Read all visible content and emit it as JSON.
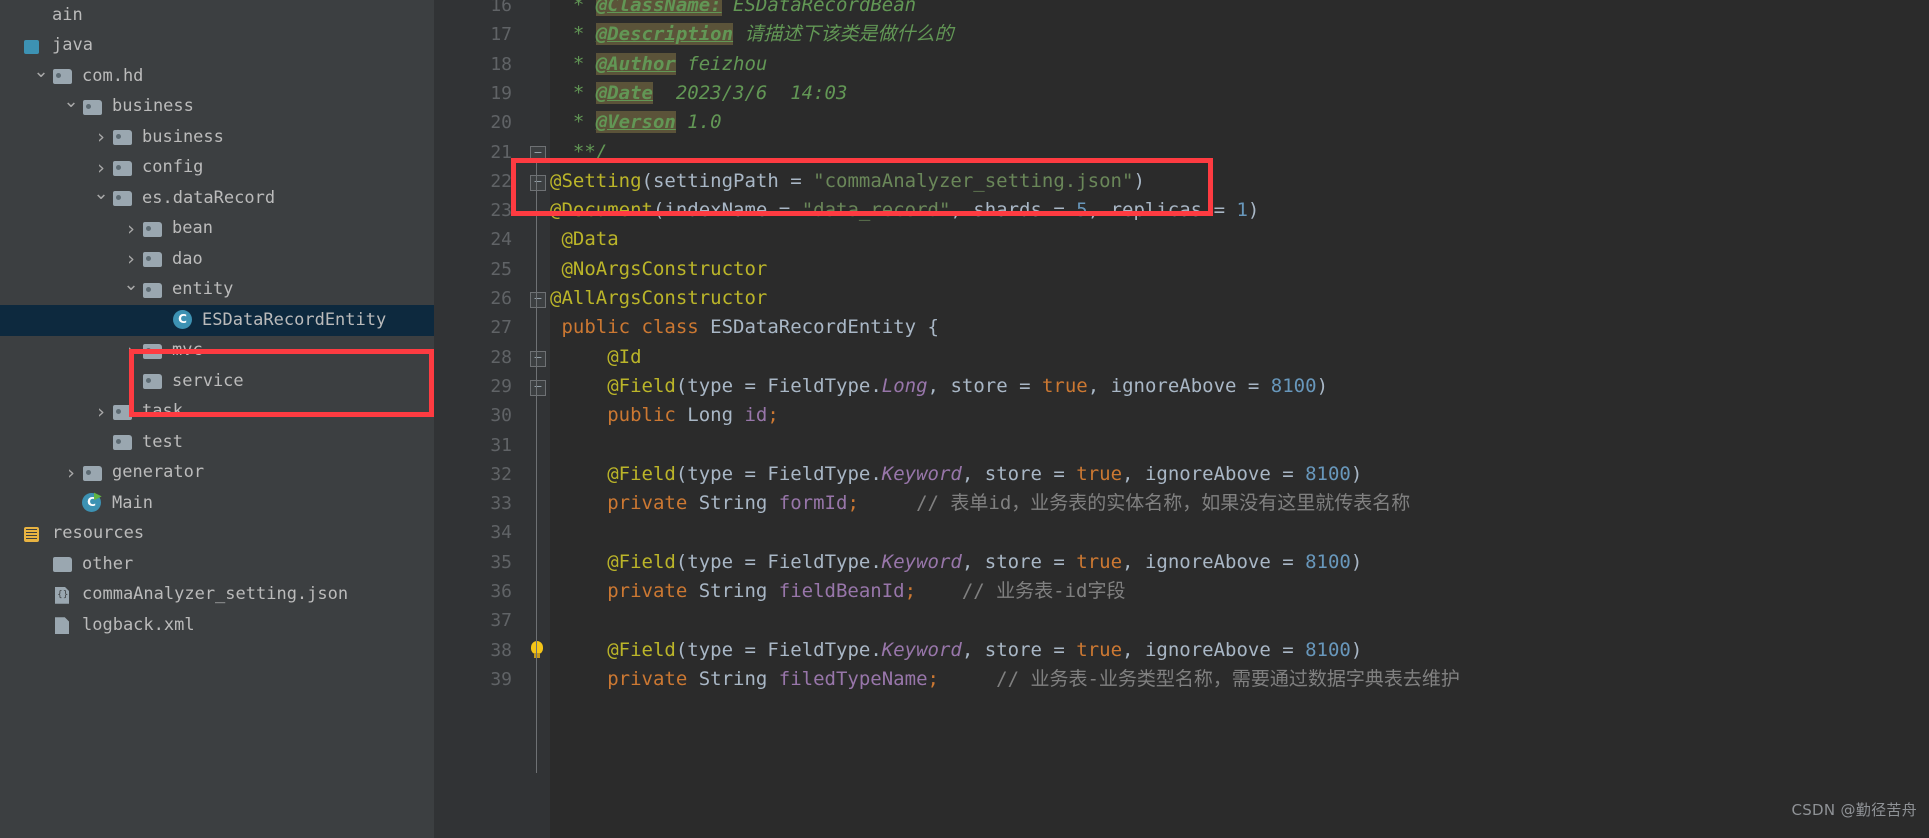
{
  "app": {
    "name": "IntelliJ IDEA Project View with Java Editor",
    "theme_accent": "#3d92b3",
    "annotation_color": "#fe3b41",
    "selection_color": "#0d293e"
  },
  "sidebar": {
    "items": [
      {
        "label": "ain",
        "indent": 0,
        "arrow": "none",
        "icon": "none",
        "selected": false
      },
      {
        "label": "java",
        "indent": 0,
        "arrow": "none",
        "icon": "source-root",
        "selected": false
      },
      {
        "label": "com.hd",
        "indent": 1,
        "arrow": "down",
        "icon": "folder",
        "selected": false
      },
      {
        "label": "business",
        "indent": 2,
        "arrow": "down",
        "icon": "folder",
        "selected": false
      },
      {
        "label": "business",
        "indent": 3,
        "arrow": "right",
        "icon": "folder",
        "selected": false
      },
      {
        "label": "config",
        "indent": 3,
        "arrow": "right",
        "icon": "folder",
        "selected": false
      },
      {
        "label": "es.dataRecord",
        "indent": 3,
        "arrow": "down",
        "icon": "folder",
        "selected": false
      },
      {
        "label": "bean",
        "indent": 4,
        "arrow": "right",
        "icon": "folder",
        "selected": false
      },
      {
        "label": "dao",
        "indent": 4,
        "arrow": "right",
        "icon": "folder",
        "selected": false
      },
      {
        "label": "entity",
        "indent": 4,
        "arrow": "down",
        "icon": "folder",
        "selected": false
      },
      {
        "label": "ESDataRecordEntity",
        "indent": 5,
        "arrow": "none",
        "icon": "class",
        "selected": true
      },
      {
        "label": "mvc",
        "indent": 4,
        "arrow": "right",
        "icon": "folder",
        "selected": false
      },
      {
        "label": "service",
        "indent": 4,
        "arrow": "right",
        "icon": "folder",
        "selected": false
      },
      {
        "label": "task",
        "indent": 3,
        "arrow": "right",
        "icon": "folder",
        "selected": false
      },
      {
        "label": "test",
        "indent": 3,
        "arrow": "none",
        "icon": "folder",
        "selected": false
      },
      {
        "label": "generator",
        "indent": 2,
        "arrow": "right",
        "icon": "folder",
        "selected": false
      },
      {
        "label": "Main",
        "indent": 2,
        "arrow": "none",
        "icon": "main-class",
        "selected": false
      },
      {
        "label": "resources",
        "indent": 0,
        "arrow": "none",
        "icon": "resource-root",
        "selected": false
      },
      {
        "label": "other",
        "indent": 1,
        "arrow": "none",
        "icon": "folder-plain",
        "selected": false
      },
      {
        "label": "commaAnalyzer_setting.json",
        "indent": 1,
        "arrow": "none",
        "icon": "json-file",
        "selected": false
      },
      {
        "label": "logback.xml",
        "indent": 1,
        "arrow": "none",
        "icon": "xml-file",
        "selected": false
      }
    ]
  },
  "editor": {
    "first_line_number": 16,
    "lines": [
      {
        "n": 16,
        "marker": "none",
        "tokens": [
          {
            "t": "  * ",
            "c": "jdoc"
          },
          {
            "t": "@ClassName:",
            "c": "jdoc-tag"
          },
          {
            "t": " ESDataRecordBean",
            "c": "jdoc"
          }
        ]
      },
      {
        "n": 17,
        "marker": "none",
        "tokens": [
          {
            "t": "  * ",
            "c": "jdoc"
          },
          {
            "t": "@Description",
            "c": "jdoc-tag"
          },
          {
            "t": " 请描述下该类是做什么的",
            "c": "jdoc"
          }
        ]
      },
      {
        "n": 18,
        "marker": "none",
        "tokens": [
          {
            "t": "  * ",
            "c": "jdoc"
          },
          {
            "t": "@Author",
            "c": "jdoc-tag"
          },
          {
            "t": " feizhou",
            "c": "jdoc"
          }
        ]
      },
      {
        "n": 19,
        "marker": "none",
        "tokens": [
          {
            "t": "  * ",
            "c": "jdoc"
          },
          {
            "t": "@Date",
            "c": "jdoc-tag"
          },
          {
            "t": "  2023/3/6  14:03",
            "c": "jdoc"
          }
        ]
      },
      {
        "n": 20,
        "marker": "none",
        "tokens": [
          {
            "t": "  * ",
            "c": "jdoc"
          },
          {
            "t": "@Verson",
            "c": "jdoc-tag"
          },
          {
            "t": " 1.0",
            "c": "jdoc"
          }
        ]
      },
      {
        "n": 21,
        "marker": "fold-end",
        "tokens": [
          {
            "t": "  **/",
            "c": "jdoc"
          }
        ]
      },
      {
        "n": 22,
        "marker": "fold-start",
        "tokens": [
          {
            "t": "@Setting",
            "c": "ann"
          },
          {
            "t": "(",
            "c": "ident"
          },
          {
            "t": "settingPath",
            "c": "ctype"
          },
          {
            "t": " = ",
            "c": "ident"
          },
          {
            "t": "\"commaAnalyzer_setting.json\"",
            "c": "str"
          },
          {
            "t": ")",
            "c": "ident"
          }
        ]
      },
      {
        "n": 23,
        "marker": "none",
        "tokens": [
          {
            "t": "@Document",
            "c": "ann"
          },
          {
            "t": "(",
            "c": "ident"
          },
          {
            "t": "indexName",
            "c": "ctype"
          },
          {
            "t": " = ",
            "c": "ident"
          },
          {
            "t": "\"data_record\"",
            "c": "str"
          },
          {
            "t": ", ",
            "c": "ident"
          },
          {
            "t": "shards",
            "c": "ctype"
          },
          {
            "t": " = ",
            "c": "ident"
          },
          {
            "t": "5",
            "c": "num"
          },
          {
            "t": ", ",
            "c": "ident"
          },
          {
            "t": "replicas",
            "c": "ctype"
          },
          {
            "t": " = ",
            "c": "ident"
          },
          {
            "t": "1",
            "c": "num"
          },
          {
            "t": ")",
            "c": "ident"
          }
        ]
      },
      {
        "n": 24,
        "marker": "none",
        "tokens": [
          {
            "t": " @Data",
            "c": "ann"
          }
        ]
      },
      {
        "n": 25,
        "marker": "none",
        "tokens": [
          {
            "t": " @NoArgsConstructor",
            "c": "ann"
          }
        ]
      },
      {
        "n": 26,
        "marker": "fold-start",
        "tokens": [
          {
            "t": "@AllArgsConstructor",
            "c": "ann"
          }
        ]
      },
      {
        "n": 27,
        "marker": "none",
        "tokens": [
          {
            "t": " public class ",
            "c": "kw"
          },
          {
            "t": "ESDataRecordEntity",
            "c": "cls"
          },
          {
            "t": " {",
            "c": "ident"
          }
        ]
      },
      {
        "n": 28,
        "marker": "fold-start",
        "tokens": [
          {
            "t": "     @Id",
            "c": "ann"
          }
        ]
      },
      {
        "n": 29,
        "marker": "fold-end",
        "tokens": [
          {
            "t": "     @Field",
            "c": "ann"
          },
          {
            "t": "(",
            "c": "ident"
          },
          {
            "t": "type",
            "c": "ctype"
          },
          {
            "t": " = ",
            "c": "ident"
          },
          {
            "t": "FieldType.",
            "c": "ctype"
          },
          {
            "t": "Long",
            "c": "italic-t"
          },
          {
            "t": ", ",
            "c": "ident"
          },
          {
            "t": "store",
            "c": "ctype"
          },
          {
            "t": " = ",
            "c": "ident"
          },
          {
            "t": "true",
            "c": "kw"
          },
          {
            "t": ", ",
            "c": "ident"
          },
          {
            "t": "ignoreAbove",
            "c": "ctype"
          },
          {
            "t": " = ",
            "c": "ident"
          },
          {
            "t": "8100",
            "c": "num"
          },
          {
            "t": ")",
            "c": "ident"
          }
        ]
      },
      {
        "n": 30,
        "marker": "none",
        "tokens": [
          {
            "t": "     public ",
            "c": "kw"
          },
          {
            "t": "Long ",
            "c": "ctype"
          },
          {
            "t": "id",
            "c": "field"
          },
          {
            "t": ";",
            "c": "kw"
          }
        ]
      },
      {
        "n": 31,
        "marker": "none",
        "tokens": []
      },
      {
        "n": 32,
        "marker": "none",
        "tokens": [
          {
            "t": "     @Field",
            "c": "ann"
          },
          {
            "t": "(",
            "c": "ident"
          },
          {
            "t": "type",
            "c": "ctype"
          },
          {
            "t": " = ",
            "c": "ident"
          },
          {
            "t": "FieldType.",
            "c": "ctype"
          },
          {
            "t": "Keyword",
            "c": "italic-t"
          },
          {
            "t": ", ",
            "c": "ident"
          },
          {
            "t": "store",
            "c": "ctype"
          },
          {
            "t": " = ",
            "c": "ident"
          },
          {
            "t": "true",
            "c": "kw"
          },
          {
            "t": ", ",
            "c": "ident"
          },
          {
            "t": "ignoreAbove",
            "c": "ctype"
          },
          {
            "t": " = ",
            "c": "ident"
          },
          {
            "t": "8100",
            "c": "num"
          },
          {
            "t": ")",
            "c": "ident"
          }
        ]
      },
      {
        "n": 33,
        "marker": "none",
        "tokens": [
          {
            "t": "     private ",
            "c": "kw"
          },
          {
            "t": "String ",
            "c": "ctype"
          },
          {
            "t": "formId",
            "c": "field"
          },
          {
            "t": ";",
            "c": "kw"
          },
          {
            "t": "     // 表单id，业务表的实体名称，如果没有这里就传表名称",
            "c": "cmt"
          }
        ]
      },
      {
        "n": 34,
        "marker": "none",
        "tokens": []
      },
      {
        "n": 35,
        "marker": "none",
        "tokens": [
          {
            "t": "     @Field",
            "c": "ann"
          },
          {
            "t": "(",
            "c": "ident"
          },
          {
            "t": "type",
            "c": "ctype"
          },
          {
            "t": " = ",
            "c": "ident"
          },
          {
            "t": "FieldType.",
            "c": "ctype"
          },
          {
            "t": "Keyword",
            "c": "italic-t"
          },
          {
            "t": ", ",
            "c": "ident"
          },
          {
            "t": "store",
            "c": "ctype"
          },
          {
            "t": " = ",
            "c": "ident"
          },
          {
            "t": "true",
            "c": "kw"
          },
          {
            "t": ", ",
            "c": "ident"
          },
          {
            "t": "ignoreAbove",
            "c": "ctype"
          },
          {
            "t": " = ",
            "c": "ident"
          },
          {
            "t": "8100",
            "c": "num"
          },
          {
            "t": ")",
            "c": "ident"
          }
        ]
      },
      {
        "n": 36,
        "marker": "none",
        "tokens": [
          {
            "t": "     private ",
            "c": "kw"
          },
          {
            "t": "String ",
            "c": "ctype"
          },
          {
            "t": "fieldBeanId",
            "c": "field"
          },
          {
            "t": ";",
            "c": "kw"
          },
          {
            "t": "    // 业务表-id字段",
            "c": "cmt"
          }
        ]
      },
      {
        "n": 37,
        "marker": "none",
        "tokens": []
      },
      {
        "n": 38,
        "marker": "bulb",
        "tokens": [
          {
            "t": "     @Field",
            "c": "ann"
          },
          {
            "t": "(",
            "c": "ident"
          },
          {
            "t": "type",
            "c": "ctype"
          },
          {
            "t": " = ",
            "c": "ident"
          },
          {
            "t": "FieldType.",
            "c": "ctype"
          },
          {
            "t": "Keyword",
            "c": "italic-t"
          },
          {
            "t": ", ",
            "c": "ident"
          },
          {
            "t": "store",
            "c": "ctype"
          },
          {
            "t": " = ",
            "c": "ident"
          },
          {
            "t": "true",
            "c": "kw"
          },
          {
            "t": ", ",
            "c": "ident"
          },
          {
            "t": "ignoreAbove",
            "c": "ctype"
          },
          {
            "t": " = ",
            "c": "ident"
          },
          {
            "t": "8100",
            "c": "num"
          },
          {
            "t": ")",
            "c": "ident"
          }
        ]
      },
      {
        "n": 39,
        "marker": "none",
        "tokens": [
          {
            "t": "     private ",
            "c": "kw"
          },
          {
            "t": "String ",
            "c": "ctype"
          },
          {
            "t": "filedTypeName",
            "c": "field"
          },
          {
            "t": ";",
            "c": "kw"
          },
          {
            "t": "     // 业务表-业务类型名称，需要通过数据字典表去维护",
            "c": "cmt"
          }
        ]
      }
    ]
  },
  "annotations": [
    {
      "name": "setting-annotation-highlight",
      "target": "@Setting line"
    },
    {
      "name": "entity-file-highlight",
      "target": "ESDataRecordEntity tree node"
    }
  ],
  "watermark": {
    "text": "CSDN @勤径苦舟"
  }
}
